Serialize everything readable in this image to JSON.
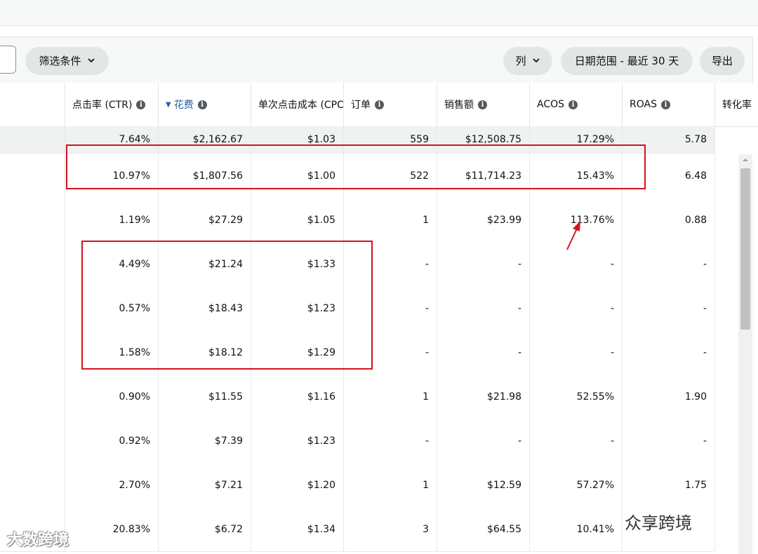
{
  "toolbar": {
    "filter_label": "筛选条件",
    "columns_label": "列",
    "date_range_label": "日期范围 - 最近 30 天",
    "export_label": "导出"
  },
  "columns": [
    {
      "label": "点击率 (CTR)",
      "info": true
    },
    {
      "label": "花费",
      "info": true,
      "sorted": true
    },
    {
      "label": "单次点击成本 (CPC)",
      "info": false
    },
    {
      "label": "订单",
      "info": true
    },
    {
      "label": "销售额",
      "info": true
    },
    {
      "label": "ACOS",
      "info": true
    },
    {
      "label": "ROAS",
      "info": true
    },
    {
      "label": "转化率",
      "info": false
    }
  ],
  "totals": [
    "7.64%",
    "$2,162.67",
    "$1.03",
    "559",
    "$12,508.75",
    "17.29%",
    "5.78"
  ],
  "rows": [
    [
      "10.97%",
      "$1,807.56",
      "$1.00",
      "522",
      "$11,714.23",
      "15.43%",
      "6.48"
    ],
    [
      "1.19%",
      "$27.29",
      "$1.05",
      "1",
      "$23.99",
      "113.76%",
      "0.88"
    ],
    [
      "4.49%",
      "$21.24",
      "$1.33",
      "-",
      "-",
      "-",
      "-"
    ],
    [
      "0.57%",
      "$18.43",
      "$1.23",
      "-",
      "-",
      "-",
      "-"
    ],
    [
      "1.58%",
      "$18.12",
      "$1.29",
      "-",
      "-",
      "-",
      "-"
    ],
    [
      "0.90%",
      "$11.55",
      "$1.16",
      "1",
      "$21.98",
      "52.55%",
      "1.90"
    ],
    [
      "0.92%",
      "$7.39",
      "$1.23",
      "-",
      "-",
      "-",
      "-"
    ],
    [
      "2.70%",
      "$7.21",
      "$1.20",
      "1",
      "$12.59",
      "57.27%",
      "1.75"
    ],
    [
      "20.83%",
      "$6.72",
      "$1.34",
      "3",
      "$64.55",
      "10.41%",
      ""
    ]
  ],
  "watermarks": {
    "left": "大数跨境",
    "right": "众享跨境"
  },
  "colors": {
    "accent": "#2162a1",
    "highlight": "#d0141e"
  },
  "icons": {
    "chevron": "chevron-down-icon",
    "info": "info-icon"
  }
}
